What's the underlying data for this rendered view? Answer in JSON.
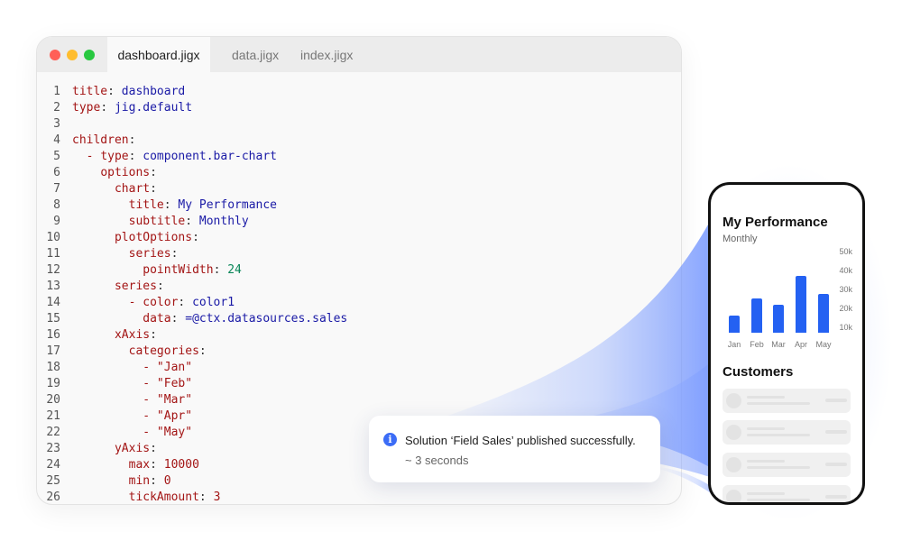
{
  "editor": {
    "tabs": [
      {
        "label": "dashboard.jigx",
        "active": true
      },
      {
        "label": "data.jigx",
        "active": false
      },
      {
        "label": "index.jigx",
        "active": false
      }
    ],
    "code_lines": [
      {
        "n": "1",
        "indent": 0,
        "k": "title",
        "v": "dashboard"
      },
      {
        "n": "2",
        "indent": 0,
        "k": "type",
        "v": "jig.default"
      },
      {
        "n": "3",
        "indent": 0,
        "k": "",
        "v": ""
      },
      {
        "n": "4",
        "indent": 0,
        "k": "children",
        "v": ""
      },
      {
        "n": "5",
        "indent": 2,
        "dash": true,
        "k": "type",
        "v": "component.bar-chart"
      },
      {
        "n": "6",
        "indent": 4,
        "k": "options",
        "v": ""
      },
      {
        "n": "7",
        "indent": 6,
        "k": "chart",
        "v": ""
      },
      {
        "n": "8",
        "indent": 8,
        "k": "title",
        "v": "My Performance"
      },
      {
        "n": "9",
        "indent": 8,
        "k": "subtitle",
        "v": "Monthly"
      },
      {
        "n": "10",
        "indent": 6,
        "k": "plotOptions",
        "v": ""
      },
      {
        "n": "11",
        "indent": 8,
        "k": "series",
        "v": ""
      },
      {
        "n": "12",
        "indent": 10,
        "k": "pointWidth",
        "v": "24",
        "num": true
      },
      {
        "n": "13",
        "indent": 6,
        "k": "series",
        "v": ""
      },
      {
        "n": "14",
        "indent": 8,
        "dash": true,
        "k": "color",
        "v": "color1"
      },
      {
        "n": "15",
        "indent": 10,
        "k": "data",
        "v": "=@ctx.datasources.sales"
      },
      {
        "n": "16",
        "indent": 6,
        "k": "xAxis",
        "v": ""
      },
      {
        "n": "17",
        "indent": 8,
        "k": "categories",
        "v": ""
      },
      {
        "n": "18",
        "indent": 10,
        "item": "\"Jan\""
      },
      {
        "n": "19",
        "indent": 10,
        "item": "\"Feb\""
      },
      {
        "n": "20",
        "indent": 10,
        "item": "\"Mar\""
      },
      {
        "n": "21",
        "indent": 10,
        "item": "\"Apr\""
      },
      {
        "n": "22",
        "indent": 10,
        "item": "\"May\""
      },
      {
        "n": "23",
        "indent": 6,
        "k": "yAxis",
        "v": ""
      },
      {
        "n": "24",
        "indent": 8,
        "k": "max",
        "v": "10000",
        "plain": true
      },
      {
        "n": "25",
        "indent": 8,
        "k": "min",
        "v": "0",
        "plain": true
      },
      {
        "n": "26",
        "indent": 8,
        "k": "tickAmount",
        "v": "3",
        "plain": true
      }
    ]
  },
  "toast": {
    "message": "Solution ‘Field Sales’ published successfully.",
    "time": "~ 3 seconds",
    "icon": "info-icon",
    "icon_glyph": "i"
  },
  "phone": {
    "chart_title": "My Performance",
    "chart_subtitle": "Monthly",
    "customers_title": "Customers",
    "customer_cards": 4,
    "chart_data": {
      "type": "bar",
      "categories": [
        "Jan",
        "Feb",
        "Mar",
        "Apr",
        "May"
      ],
      "values": [
        10500,
        21000,
        17000,
        35000,
        24000
      ],
      "yticks": [
        "50k",
        "40k",
        "30k",
        "20k",
        "10k"
      ],
      "ylim": [
        0,
        50000
      ],
      "color": "#2461f2"
    }
  }
}
